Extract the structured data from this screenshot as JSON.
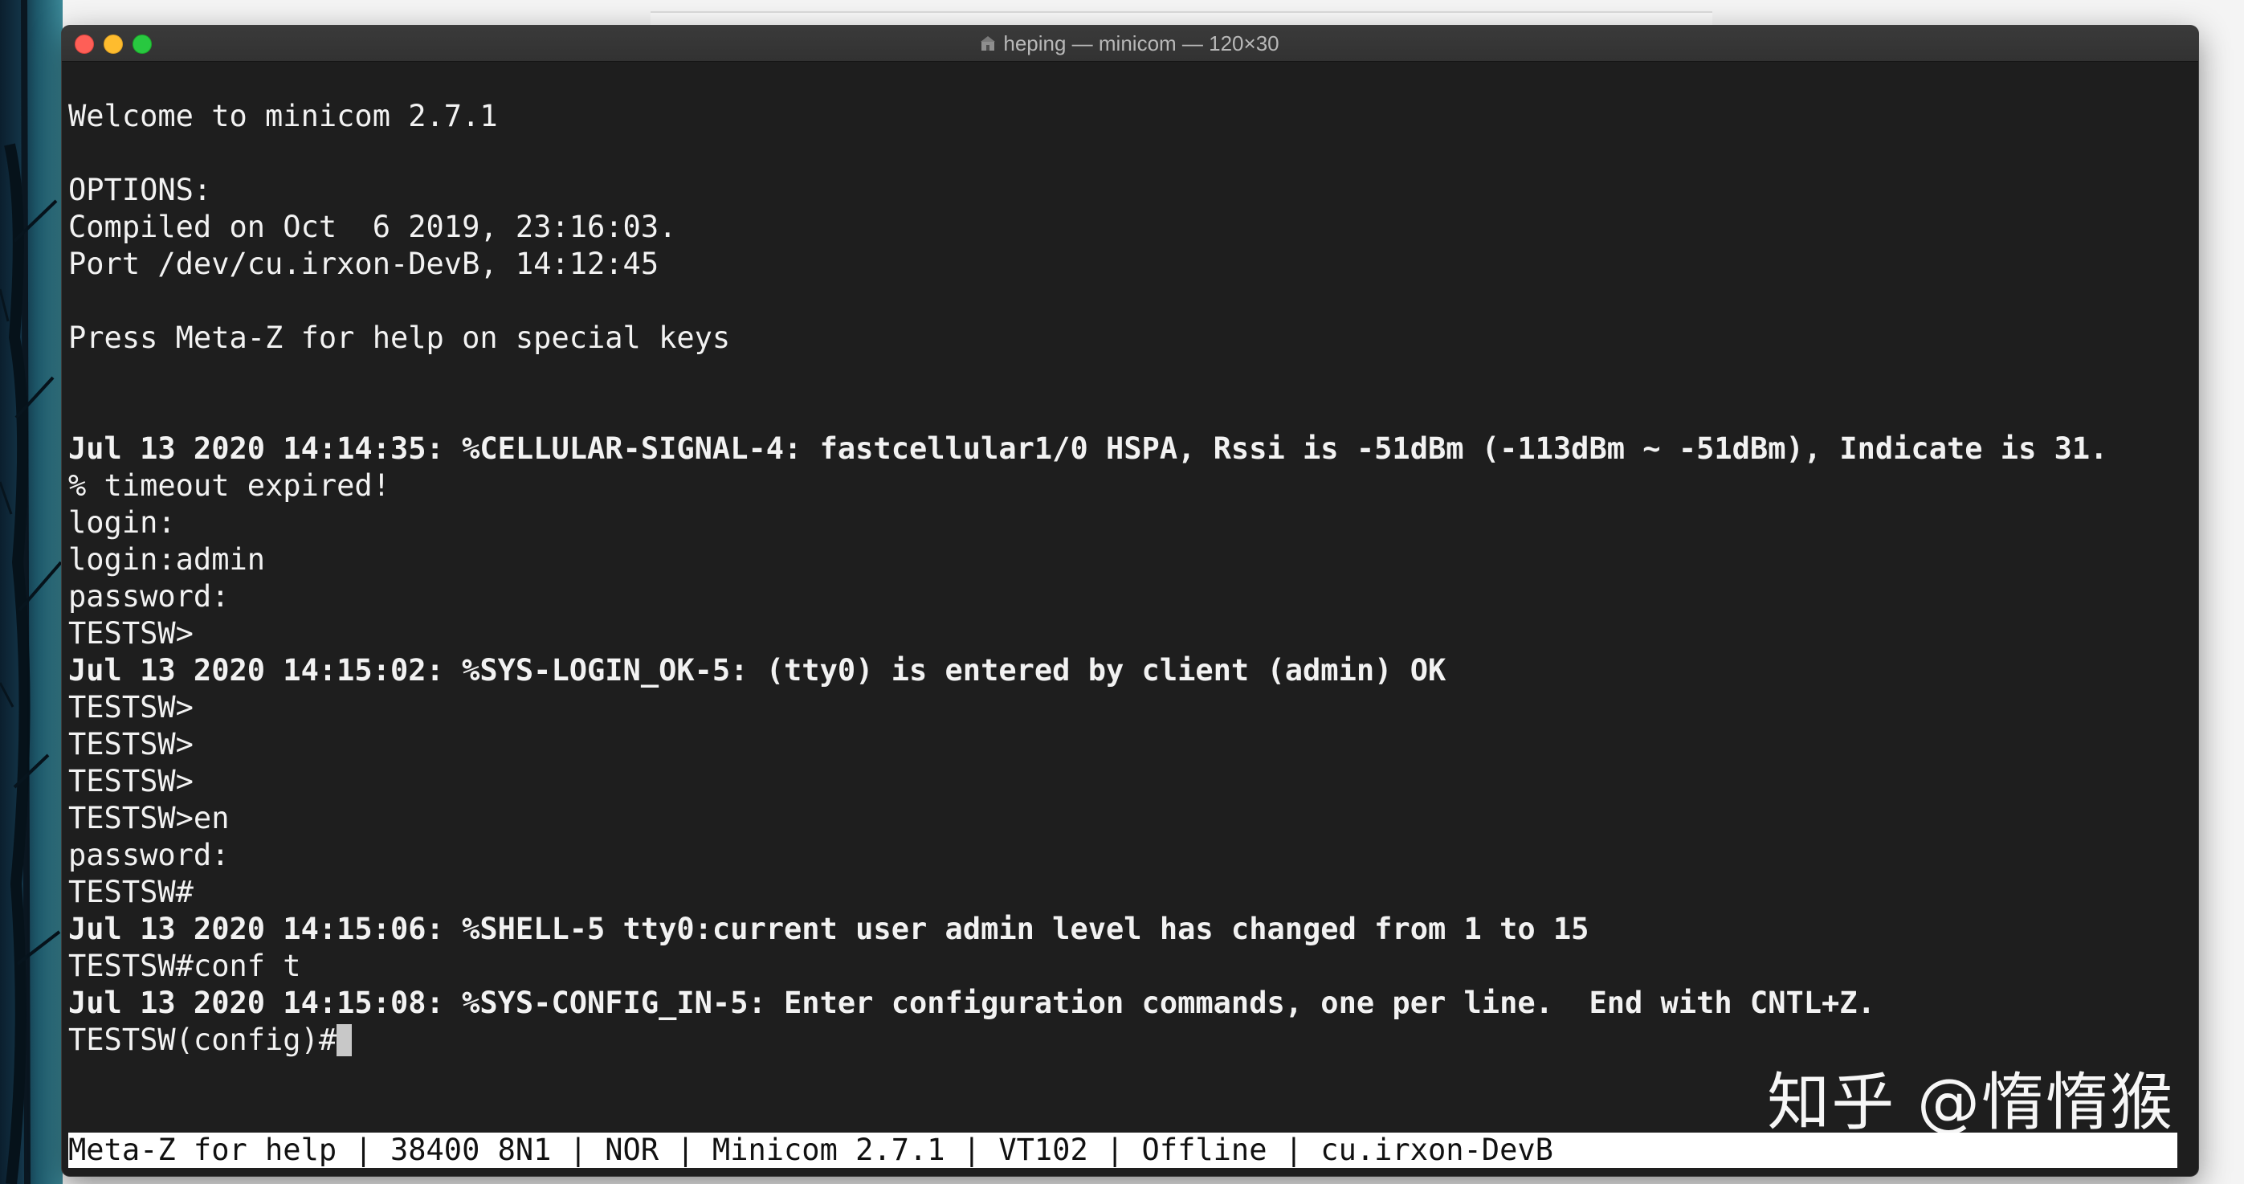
{
  "window": {
    "title": "heping — minicom — 120×30"
  },
  "terminal": {
    "lines": [
      {
        "text": "",
        "bold": false
      },
      {
        "text": "Welcome to minicom 2.7.1",
        "bold": false
      },
      {
        "text": "",
        "bold": false
      },
      {
        "text": "OPTIONS:",
        "bold": false
      },
      {
        "text": "Compiled on Oct  6 2019, 23:16:03.",
        "bold": false
      },
      {
        "text": "Port /dev/cu.irxon-DevB, 14:12:45",
        "bold": false
      },
      {
        "text": "",
        "bold": false
      },
      {
        "text": "Press Meta-Z for help on special keys",
        "bold": false
      },
      {
        "text": "",
        "bold": false
      },
      {
        "text": "",
        "bold": false
      },
      {
        "text": "Jul 13 2020 14:14:35: %CELLULAR-SIGNAL-4: fastcellular1/0 HSPA, Rssi is -51dBm (-113dBm ~ -51dBm), Indicate is 31.",
        "bold": true
      },
      {
        "text": "% timeout expired!",
        "bold": false
      },
      {
        "text": "login:",
        "bold": false
      },
      {
        "text": "login:admin",
        "bold": false
      },
      {
        "text": "password:",
        "bold": false
      },
      {
        "text": "TESTSW>",
        "bold": false
      },
      {
        "text": "Jul 13 2020 14:15:02: %SYS-LOGIN_OK-5: (tty0) is entered by client (admin) OK",
        "bold": true
      },
      {
        "text": "TESTSW>",
        "bold": false
      },
      {
        "text": "TESTSW>",
        "bold": false
      },
      {
        "text": "TESTSW>",
        "bold": false
      },
      {
        "text": "TESTSW>en",
        "bold": false
      },
      {
        "text": "password:",
        "bold": false
      },
      {
        "text": "TESTSW#",
        "bold": false
      },
      {
        "text": "Jul 13 2020 14:15:06: %SHELL-5 tty0:current user admin level has changed from 1 to 15",
        "bold": true
      },
      {
        "text": "TESTSW#conf t",
        "bold": false
      },
      {
        "text": "Jul 13 2020 14:15:08: %SYS-CONFIG_IN-5: Enter configuration commands, one per line.  End with CNTL+Z.",
        "bold": true
      },
      {
        "text": "TESTSW(config)#",
        "bold": false
      }
    ]
  },
  "status_bar": {
    "text": "Meta-Z for help | 38400 8N1 | NOR | Minicom 2.7.1 | VT102 | Offline | cu.irxon-DevB"
  },
  "watermark": {
    "text": "知乎 @惰惰猴"
  },
  "colors": {
    "terminal_bg": "#1e1e1e",
    "terminal_fg": "#f2f2f2",
    "titlebar_bg": "#363636",
    "close": "#fe5f57",
    "minimize": "#febc2e",
    "zoom": "#28c840",
    "status_bg": "#ffffff"
  },
  "icons": {
    "title_icon": "home-folder-icon",
    "close": "close-icon",
    "minimize": "minimize-icon",
    "zoom": "zoom-icon"
  }
}
